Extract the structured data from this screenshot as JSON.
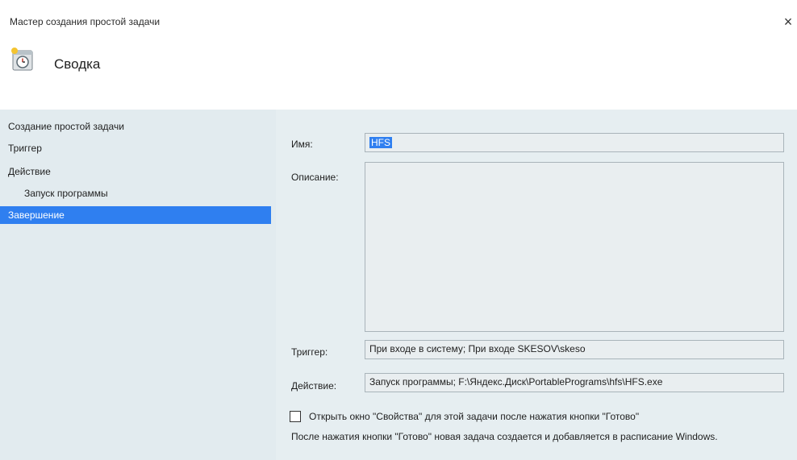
{
  "window": {
    "title": "Мастер создания простой задачи",
    "close_glyph": "×"
  },
  "header": {
    "title": "Сводка",
    "icon": "clock-task-icon"
  },
  "sidebar": {
    "items": [
      {
        "label": "Создание простой задачи"
      },
      {
        "label": "Триггер"
      },
      {
        "label": "Действие"
      },
      {
        "label": "Запуск программы"
      },
      {
        "label": "Завершение"
      }
    ],
    "selected_index": 4
  },
  "form": {
    "name_label": "Имя:",
    "name_value": "HFS",
    "description_label": "Описание:",
    "description_value": "",
    "trigger_label": "Триггер:",
    "trigger_value": "При входе в систему; При входе SKESOV\\skeso",
    "action_label": "Действие:",
    "action_value": "Запуск программы; F:\\Яндекс.Диск\\PortablePrograms\\hfs\\HFS.exe"
  },
  "options": {
    "open_properties_label": "Открыть окно \"Свойства\" для этой задачи после нажатия кнопки \"Готово\"",
    "open_properties_checked": false,
    "info_text": "После нажатия кнопки \"Готово\" новая задача создается и добавляется в расписание Windows."
  },
  "colors": {
    "selection": "#2f7ff0",
    "background": "#e2ebef",
    "header_bg": "#ffffff"
  }
}
